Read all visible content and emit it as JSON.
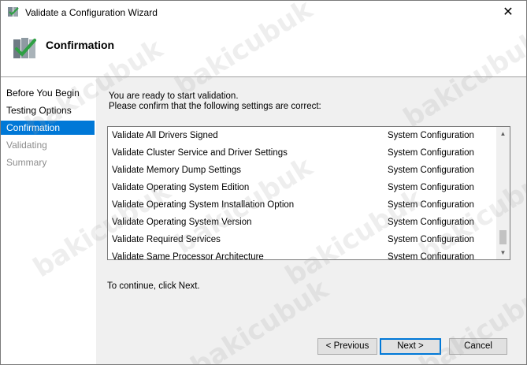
{
  "window": {
    "title": "Validate a Configuration Wizard",
    "close_glyph": "✕"
  },
  "header": {
    "title": "Confirmation"
  },
  "sidebar": {
    "items": [
      {
        "label": "Before You Begin",
        "state": "normal"
      },
      {
        "label": "Testing Options",
        "state": "normal"
      },
      {
        "label": "Confirmation",
        "state": "selected"
      },
      {
        "label": "Validating",
        "state": "disabled"
      },
      {
        "label": "Summary",
        "state": "disabled"
      }
    ]
  },
  "main": {
    "intro_line1": "You are ready to start validation.",
    "intro_line2": "Please confirm that the following settings are correct:",
    "rows": [
      {
        "test": "Validate All Drivers Signed",
        "category": "System Configuration"
      },
      {
        "test": "Validate Cluster Service and Driver Settings",
        "category": "System Configuration"
      },
      {
        "test": "Validate Memory Dump Settings",
        "category": "System Configuration"
      },
      {
        "test": "Validate Operating System Edition",
        "category": "System Configuration"
      },
      {
        "test": "Validate Operating System Installation Option",
        "category": "System Configuration"
      },
      {
        "test": "Validate Operating System Version",
        "category": "System Configuration"
      },
      {
        "test": "Validate Required Services",
        "category": "System Configuration"
      },
      {
        "test": "Validate Same Processor Architecture",
        "category": "System Configuration"
      }
    ],
    "continue_text": "To continue, click Next."
  },
  "buttons": {
    "previous": "< Previous",
    "next": "Next >",
    "cancel": "Cancel"
  },
  "watermark": "bakicubuk",
  "colors": {
    "selection": "#0078d7",
    "panel_bg": "#f0f0f0",
    "disabled_text": "#8d8d8d"
  }
}
